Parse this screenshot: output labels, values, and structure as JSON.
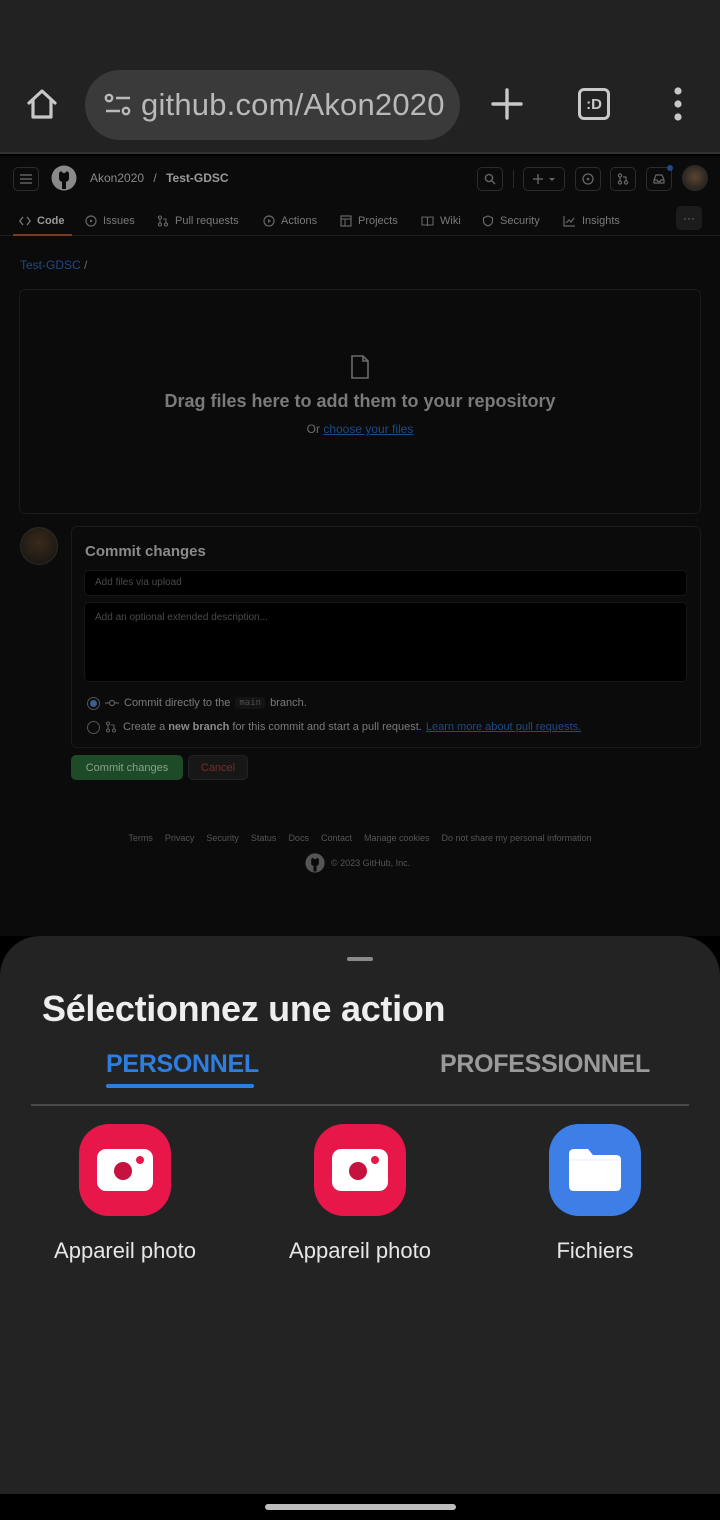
{
  "browser": {
    "url": "github.com/Akon2020",
    "tabs_label": ":D"
  },
  "github": {
    "owner": "Akon2020",
    "repo": "Test-GDSC",
    "breadcrumb_sep": "/",
    "nav_tabs": [
      {
        "label": "Code",
        "icon": "code-icon",
        "active": true
      },
      {
        "label": "Issues",
        "icon": "issue-icon"
      },
      {
        "label": "Pull requests",
        "icon": "pull-request-icon"
      },
      {
        "label": "Actions",
        "icon": "play-icon"
      },
      {
        "label": "Projects",
        "icon": "table-icon"
      },
      {
        "label": "Wiki",
        "icon": "book-icon"
      },
      {
        "label": "Security",
        "icon": "shield-icon"
      },
      {
        "label": "Insights",
        "icon": "graph-icon"
      }
    ],
    "path": "Test-GDSC",
    "drop_title": "Drag files here to add them to your repository",
    "drop_or": "Or",
    "drop_link": "choose your files",
    "commit": {
      "title": "Commit changes",
      "summary_placeholder": "Add files via upload",
      "description_placeholder": "Add an optional extended description...",
      "option_direct_pre": "Commit directly to the",
      "option_direct_branch": "main",
      "option_direct_post": "branch.",
      "option_new_pre": "Create a",
      "option_new_bold": "new branch",
      "option_new_post": "for this commit and start a pull request.",
      "option_new_link": "Learn more about pull requests.",
      "commit_button": "Commit changes",
      "cancel_button": "Cancel"
    },
    "footer_links": [
      "Terms",
      "Privacy",
      "Security",
      "Status",
      "Docs",
      "Contact",
      "Manage cookies",
      "Do not share my personal information"
    ],
    "footer_copy": "© 2023 GitHub, Inc."
  },
  "sheet": {
    "title": "Sélectionnez une action",
    "tab_personal": "PERSONNEL",
    "tab_professional": "PROFESSIONNEL",
    "apps": [
      {
        "label": "Appareil photo",
        "icon": "camera-icon"
      },
      {
        "label": "Appareil photo",
        "icon": "camera-icon"
      },
      {
        "label": "Fichiers",
        "icon": "folder-icon"
      }
    ]
  },
  "colors": {
    "accent_blue": "#2e7ee0",
    "camera_red": "#e8174a",
    "files_blue": "#3d7fe6"
  }
}
